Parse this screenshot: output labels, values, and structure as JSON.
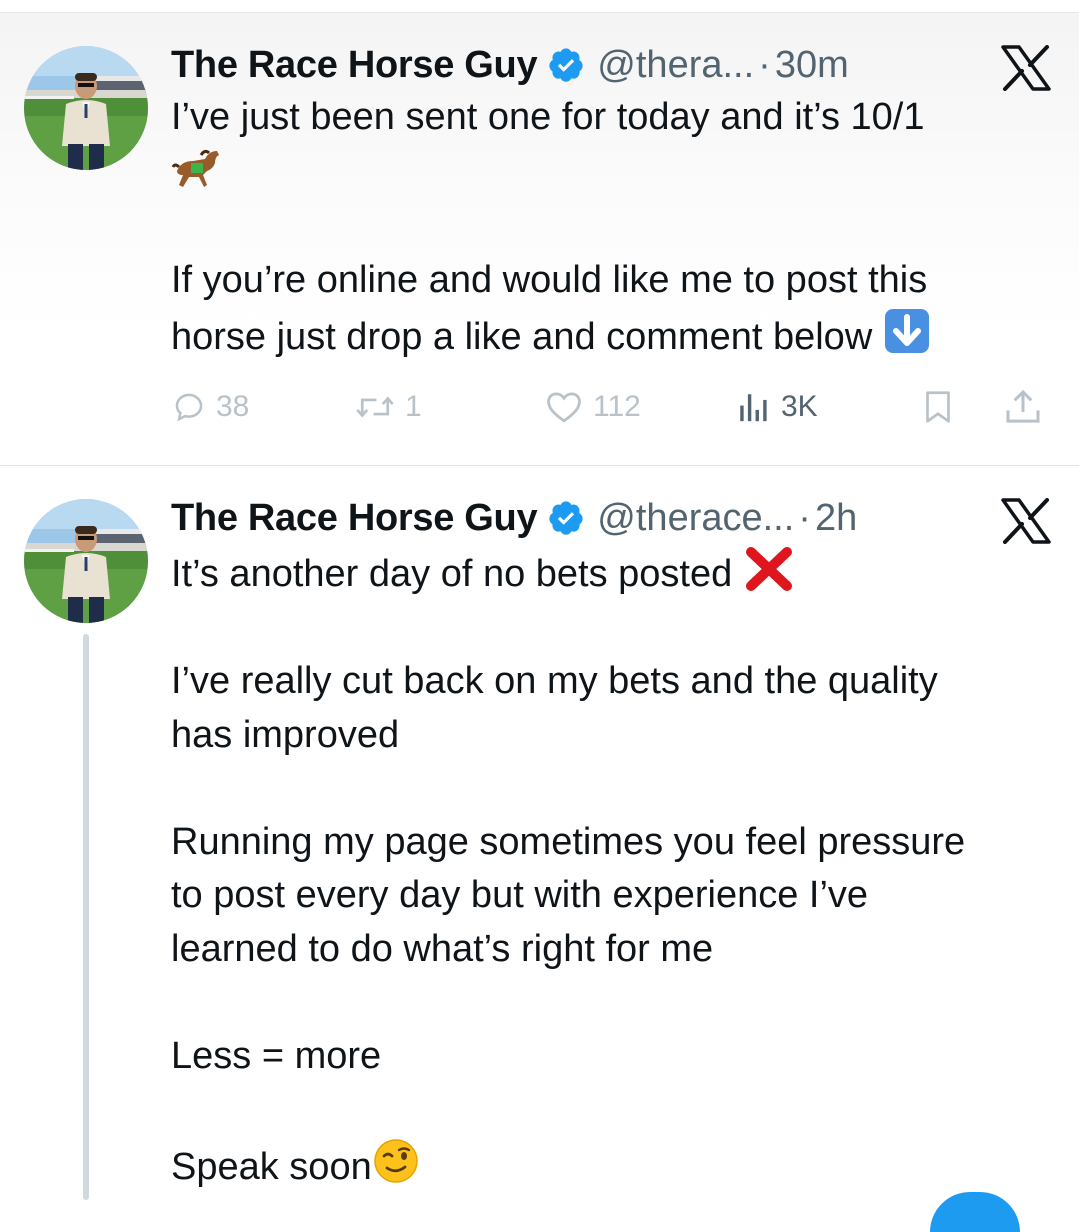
{
  "tweets": [
    {
      "display_name": "The Race Horse Guy",
      "handle": "@thera...",
      "separator": "·",
      "time": "30m",
      "verified": true,
      "avatar_icon": "profile-photo-man-racecourse",
      "lines": [
        "I’ve just been sent one for today and it’s 10/1",
        "",
        "If you’re online and would like me to post this",
        "horse just drop a like and comment below"
      ],
      "emojis": [
        "racehorse",
        "down-arrow"
      ],
      "stats": {
        "replies": "38",
        "retweets": "1",
        "likes": "112",
        "views": "3K"
      }
    },
    {
      "display_name": "The Race Horse Guy",
      "handle": "@therace...",
      "separator": "·",
      "time": "2h",
      "verified": true,
      "avatar_icon": "profile-photo-man-racecourse",
      "lines": [
        "It’s another day of no bets posted",
        "I’ve really cut back on my bets and the quality",
        "has improved",
        "Running my page sometimes you feel pressure",
        "to post every day but with experience I’ve",
        "learned to do what’s right for me",
        "Less = more",
        "Speak soon"
      ],
      "emojis": [
        "red-cross-mark",
        "winking-face"
      ]
    }
  ],
  "colors": {
    "verified_blue": "#1d9bf0",
    "secondary_text": "#536471",
    "primary_text": "#0f1419",
    "thread_line": "#cfd9de"
  },
  "icons": [
    "verified-badge-icon",
    "x-logo-icon",
    "reply-icon",
    "retweet-icon",
    "like-icon",
    "views-icon",
    "bookmark-icon",
    "share-icon"
  ]
}
